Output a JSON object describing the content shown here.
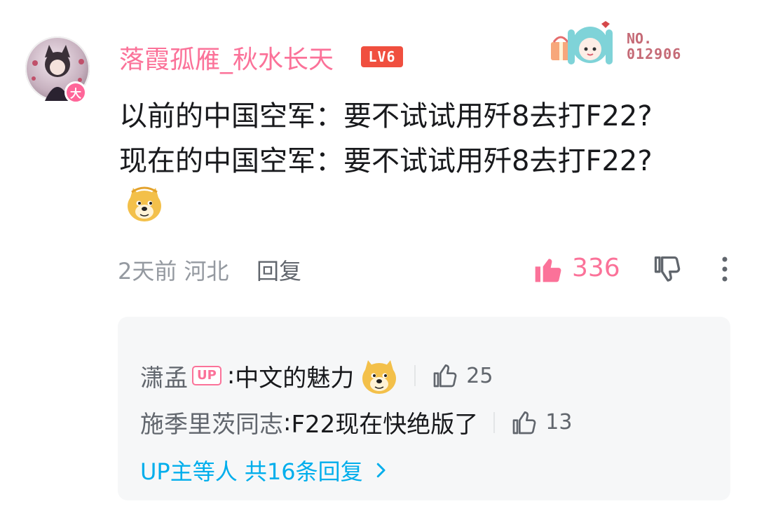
{
  "comment": {
    "username": "落霞孤雁_秋水长天",
    "level_badge": "LV6",
    "avatar_badge": "大",
    "deco_no_label": "NO.",
    "deco_number": "012906",
    "line1": "以前的中国空军：要不试试用歼8去打F22?",
    "line2": "现在的中国空军：要不试试用歼8去打F22?",
    "time": "2天前",
    "location": "河北",
    "reply_label": "回复",
    "like_count": "336"
  },
  "replies": [
    {
      "name": "潇孟",
      "tag": "UP",
      "colon": ": ",
      "text": "中文的魅力",
      "likes": "25",
      "has_emoji": true
    },
    {
      "name": "施季里茨同志",
      "tag": "",
      "colon": ": ",
      "text": "F22现在快绝版了",
      "likes": "13",
      "has_emoji": false
    }
  ],
  "more_replies": "UP主等人 共16条回复",
  "colors": {
    "accent": "#fb7299",
    "link": "#00aeec",
    "level": "#f04f3f",
    "text": "#18191c",
    "muted": "#9499a0"
  },
  "icons": [
    "thumbs-up-filled-icon",
    "thumbs-down-icon",
    "more-vertical-icon",
    "thumbs-up-outline-icon",
    "chevron-right-icon",
    "doge-emoji"
  ]
}
